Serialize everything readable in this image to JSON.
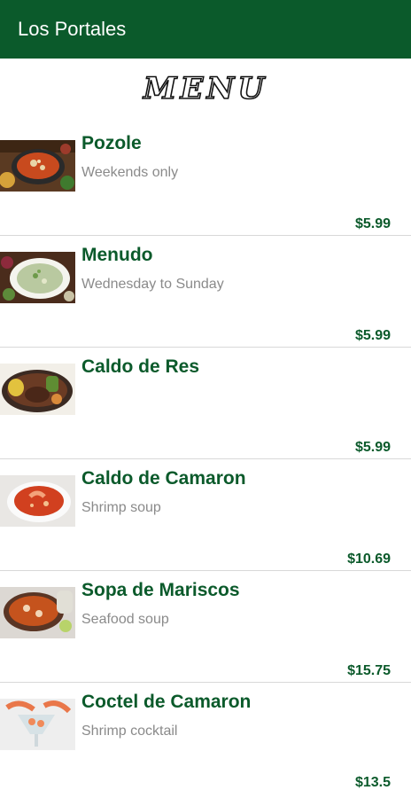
{
  "app": {
    "title": "Los Portales"
  },
  "menu_heading": "MENU",
  "items": [
    {
      "name": "Pozole",
      "description": "Weekends only",
      "price": "$5.99",
      "image": "pozole-photo"
    },
    {
      "name": "Menudo",
      "description": "Wednesday to Sunday",
      "price": "$5.99",
      "image": "menudo-photo"
    },
    {
      "name": "Caldo de Res",
      "description": "",
      "price": "$5.99",
      "image": "caldo-de-res-photo"
    },
    {
      "name": "Caldo de Camaron",
      "description": "Shrimp soup",
      "price": "$10.69",
      "image": "caldo-de-camaron-photo"
    },
    {
      "name": "Sopa de Mariscos",
      "description": "Seafood soup",
      "price": "$15.75",
      "image": "sopa-de-mariscos-photo"
    },
    {
      "name": "Coctel de Camaron",
      "description": "Shrimp cocktail",
      "price": "$13.5",
      "image": "coctel-de-camaron-photo"
    }
  ],
  "colors": {
    "brand": "#0b5a2b",
    "price": "#0b5a2b",
    "description": "#8a8a8a"
  }
}
